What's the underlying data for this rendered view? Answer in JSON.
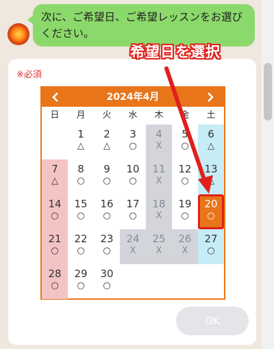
{
  "chat": {
    "message": "次に、ご希望日、ご希望レッスンをお選びください。"
  },
  "form": {
    "required_label": "※必須",
    "ok_label": "OK"
  },
  "calendar": {
    "title": "2024年4月",
    "weekdays": [
      "日",
      "月",
      "火",
      "水",
      "木",
      "金",
      "土"
    ],
    "selected_day": "20",
    "days": [
      {
        "day": "1",
        "mark": "△",
        "col": 1,
        "row": 0,
        "status": "open"
      },
      {
        "day": "2",
        "mark": "△",
        "col": 2,
        "row": 0,
        "status": "open"
      },
      {
        "day": "3",
        "mark": "○",
        "col": 3,
        "row": 0,
        "status": "open"
      },
      {
        "day": "4",
        "mark": "X",
        "col": 4,
        "row": 0,
        "status": "closed"
      },
      {
        "day": "5",
        "mark": "○",
        "col": 5,
        "row": 0,
        "status": "open"
      },
      {
        "day": "6",
        "mark": "△",
        "col": 6,
        "row": 0,
        "status": "open"
      },
      {
        "day": "7",
        "mark": "△",
        "col": 0,
        "row": 1,
        "status": "open"
      },
      {
        "day": "8",
        "mark": "○",
        "col": 1,
        "row": 1,
        "status": "open"
      },
      {
        "day": "9",
        "mark": "○",
        "col": 2,
        "row": 1,
        "status": "open"
      },
      {
        "day": "10",
        "mark": "○",
        "col": 3,
        "row": 1,
        "status": "open"
      },
      {
        "day": "11",
        "mark": "X",
        "col": 4,
        "row": 1,
        "status": "closed"
      },
      {
        "day": "12",
        "mark": "○",
        "col": 5,
        "row": 1,
        "status": "open"
      },
      {
        "day": "13",
        "mark": "△",
        "col": 6,
        "row": 1,
        "status": "open"
      },
      {
        "day": "14",
        "mark": "○",
        "col": 0,
        "row": 2,
        "status": "open"
      },
      {
        "day": "15",
        "mark": "○",
        "col": 1,
        "row": 2,
        "status": "open"
      },
      {
        "day": "16",
        "mark": "○",
        "col": 2,
        "row": 2,
        "status": "open"
      },
      {
        "day": "17",
        "mark": "○",
        "col": 3,
        "row": 2,
        "status": "open"
      },
      {
        "day": "18",
        "mark": "X",
        "col": 4,
        "row": 2,
        "status": "closed"
      },
      {
        "day": "19",
        "mark": "○",
        "col": 5,
        "row": 2,
        "status": "open"
      },
      {
        "day": "20",
        "mark": "○",
        "col": 6,
        "row": 2,
        "status": "selected"
      },
      {
        "day": "21",
        "mark": "○",
        "col": 0,
        "row": 3,
        "status": "open"
      },
      {
        "day": "22",
        "mark": "○",
        "col": 1,
        "row": 3,
        "status": "open"
      },
      {
        "day": "23",
        "mark": "○",
        "col": 2,
        "row": 3,
        "status": "open"
      },
      {
        "day": "24",
        "mark": "X",
        "col": 3,
        "row": 3,
        "status": "closed"
      },
      {
        "day": "25",
        "mark": "X",
        "col": 4,
        "row": 3,
        "status": "closed"
      },
      {
        "day": "26",
        "mark": "X",
        "col": 5,
        "row": 3,
        "status": "closed"
      },
      {
        "day": "27",
        "mark": "○",
        "col": 6,
        "row": 3,
        "status": "open"
      },
      {
        "day": "28",
        "mark": "○",
        "col": 0,
        "row": 4,
        "status": "open"
      },
      {
        "day": "29",
        "mark": "○",
        "col": 1,
        "row": 4,
        "status": "open"
      },
      {
        "day": "30",
        "mark": "○",
        "col": 2,
        "row": 4,
        "status": "open"
      }
    ]
  },
  "annotation": {
    "label": "希望日を選択"
  },
  "icons": {
    "prev": "chevron-left-icon",
    "next": "chevron-right-icon",
    "avatar": "avatar-icon"
  },
  "colors": {
    "accent": "#e8751a",
    "annotation": "#e0201c",
    "bubble": "#8cd96b",
    "closed": "#d3d5db",
    "sunday": "#f4c3c4",
    "saturday": "#c6ecf6"
  }
}
